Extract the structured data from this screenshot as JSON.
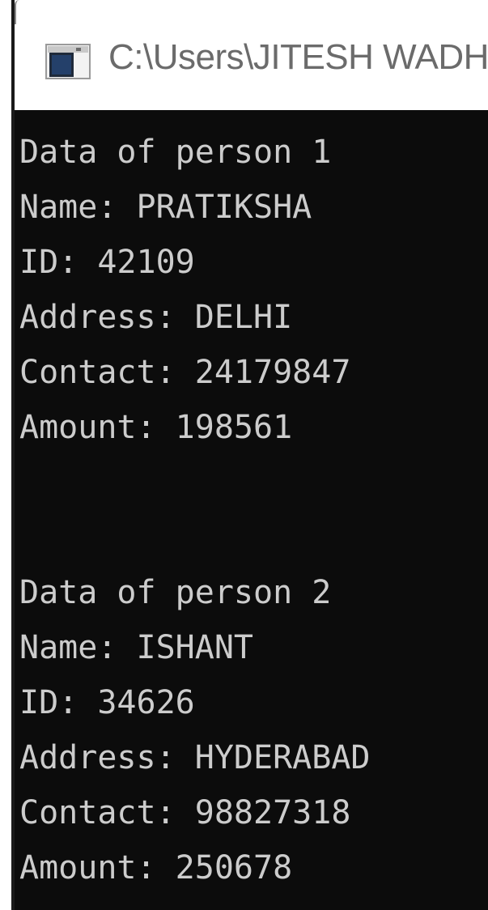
{
  "window": {
    "title": "C:\\Users\\JITESH WADH"
  },
  "console": {
    "lines": [
      "Data of person 1",
      "Name: PRATIKSHA",
      "ID: 42109",
      "Address: DELHI",
      "Contact: 24179847",
      "Amount: 198561",
      "",
      "",
      "Data of person 2",
      "Name: ISHANT",
      "ID: 34626",
      "Address: HYDERABAD",
      "Contact: 98827318",
      "Amount: 250678"
    ]
  },
  "colors": {
    "console_background": "#0c0c0c",
    "console_text": "#cccccc",
    "titlebar_background": "#ffffff",
    "title_text": "#6b6b6b"
  },
  "icons": {
    "app_icon": "console-window-icon"
  }
}
